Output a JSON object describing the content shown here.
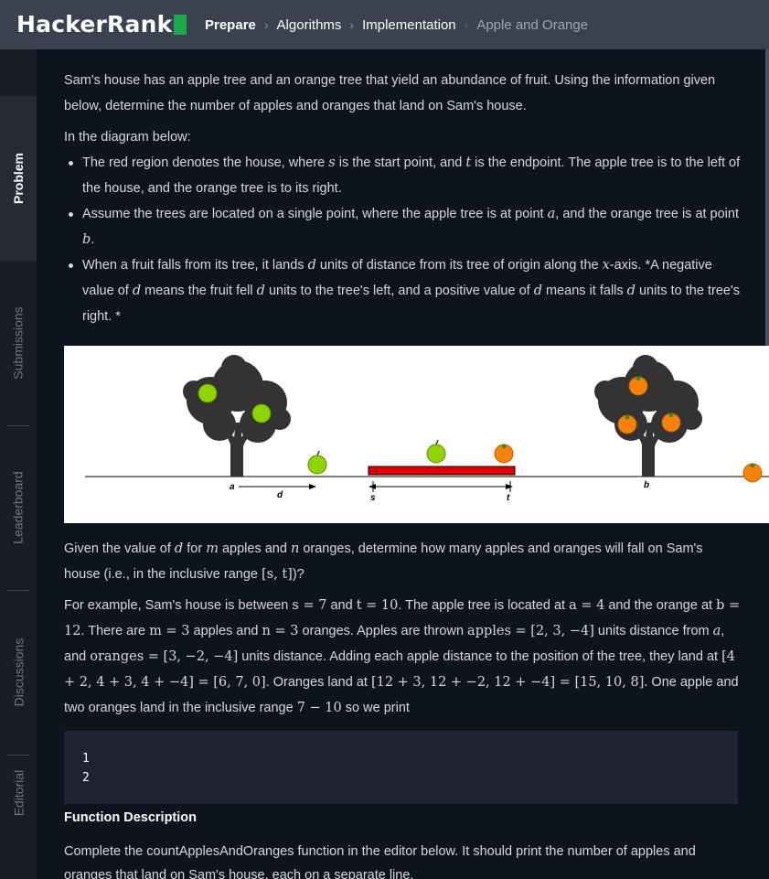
{
  "header": {
    "logo_text": "HackerRank",
    "breadcrumb": [
      "Prepare",
      "Algorithms",
      "Implementation"
    ],
    "current": "Apple and Orange"
  },
  "sidebar": {
    "tabs": [
      "Problem",
      "Submissions",
      "Leaderboard",
      "Discussions",
      "Editorial"
    ],
    "active": "Problem"
  },
  "problem": {
    "intro": "Sam's house has an apple tree and an orange tree that yield an abundance of fruit. Using the information given below, determine the number of apples and oranges that land on Sam's house.",
    "diagram_lead": "In the diagram below:",
    "bullet1_a": "The red region denotes the house, where ",
    "bullet1_s": "s",
    "bullet1_b": " is the start point, and ",
    "bullet1_t": "t",
    "bullet1_c": " is the endpoint. The apple tree is to the left of the house, and the orange tree is to its right.",
    "bullet2_a": "Assume the trees are located on a single point, where the apple tree is at point ",
    "bullet2_av": "a",
    "bullet2_b": ", and the orange tree is at point ",
    "bullet2_bv": "b",
    "bullet2_c": ".",
    "bullet3_a": "When a fruit falls from its tree, it lands ",
    "bullet3_d": "d",
    "bullet3_b": " units of distance from its tree of origin along the ",
    "bullet3_x": "x",
    "bullet3_c": "-axis. *A negative value of ",
    "bullet3_e": " means the fruit fell ",
    "bullet3_f": " units to the tree's left, and a positive value of ",
    "bullet3_g": " means it falls ",
    "bullet3_h": " units to the tree's right. *"
  },
  "diagram": {
    "label_a": "a",
    "label_d": "d",
    "label_s": "s",
    "label_t": "t",
    "label_b": "b",
    "colors": {
      "house": "#e00000",
      "tree": "#333333",
      "apple": "#8fd400",
      "orange": "#f5820d"
    }
  },
  "example": {
    "q1": "Given the value of ",
    "q_d": "d",
    "q2": " for ",
    "q_m": "m",
    "q3": " apples and ",
    "q_n": "n",
    "q4": " oranges, determine how many apples and oranges will fall on Sam's house (i.e., in the inclusive range ",
    "q_range": "[s, t]",
    "q5": ")?",
    "e1": "For example, Sam's house is between ",
    "e_s": "s = 7",
    "e2": " and ",
    "e_t": "t = 10",
    "e3": ". The apple tree is located at ",
    "e_a": "a = 4",
    "e4": " and the orange at ",
    "e_b": "b = 12",
    "e5": ". There are ",
    "e_m": "m = 3",
    "e6": " apples and ",
    "e_n": "n = 3",
    "e7": " oranges. Apples are thrown ",
    "e_apples": "apples = [2, 3, −4]",
    "e8": " units distance from ",
    "e_a2": "a",
    "e9": ", and ",
    "e_oranges": "oranges = [3, −2, −4]",
    "e10": " units distance. Adding each apple distance to the position of the tree, they land at ",
    "e_land1": "[4 + 2, 4 + 3, 4 + −4] = [6, 7, 0]",
    "e11": ". Oranges land at ",
    "e_land2": "[12 + 3, 12 + −2, 12 + −4] = [15, 10, 8]",
    "e12": ". One apple and two oranges land in the inclusive range ",
    "e_range": "7 − 10",
    "e13": " so we print"
  },
  "output": {
    "line1": "1",
    "line2": "2"
  },
  "function_description": {
    "heading": "Function Description",
    "text": "Complete the countApplesAndOranges function in the editor below. It should print the number of apples and oranges that land on Sam's house, each on a separate line."
  }
}
